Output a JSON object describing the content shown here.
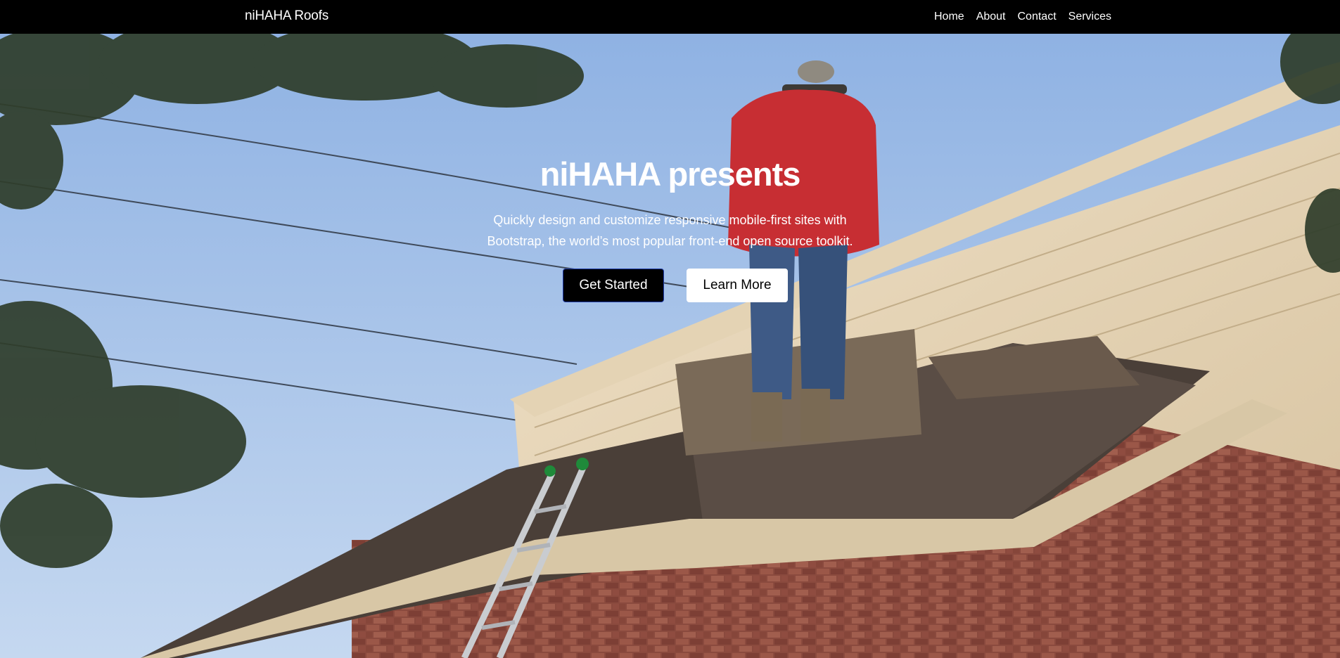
{
  "navbar": {
    "brand": "niHAHA Roofs",
    "links": [
      "Home",
      "About",
      "Contact",
      "Services"
    ]
  },
  "hero": {
    "title": "niHAHA presents",
    "subtitle_line1": "Quickly design and customize responsive mobile-first sites with",
    "subtitle_line2": "Bootstrap, the world’s most popular front-end open source toolkit.",
    "primary_button": "Get Started",
    "secondary_button": "Learn More",
    "background_image": "roofer-on-house-roof-photo"
  },
  "colors": {
    "navbar_bg": "#000000",
    "primary_button_bg": "#000000",
    "secondary_button_bg": "#ffffff",
    "sky": "#a9c4e8"
  }
}
